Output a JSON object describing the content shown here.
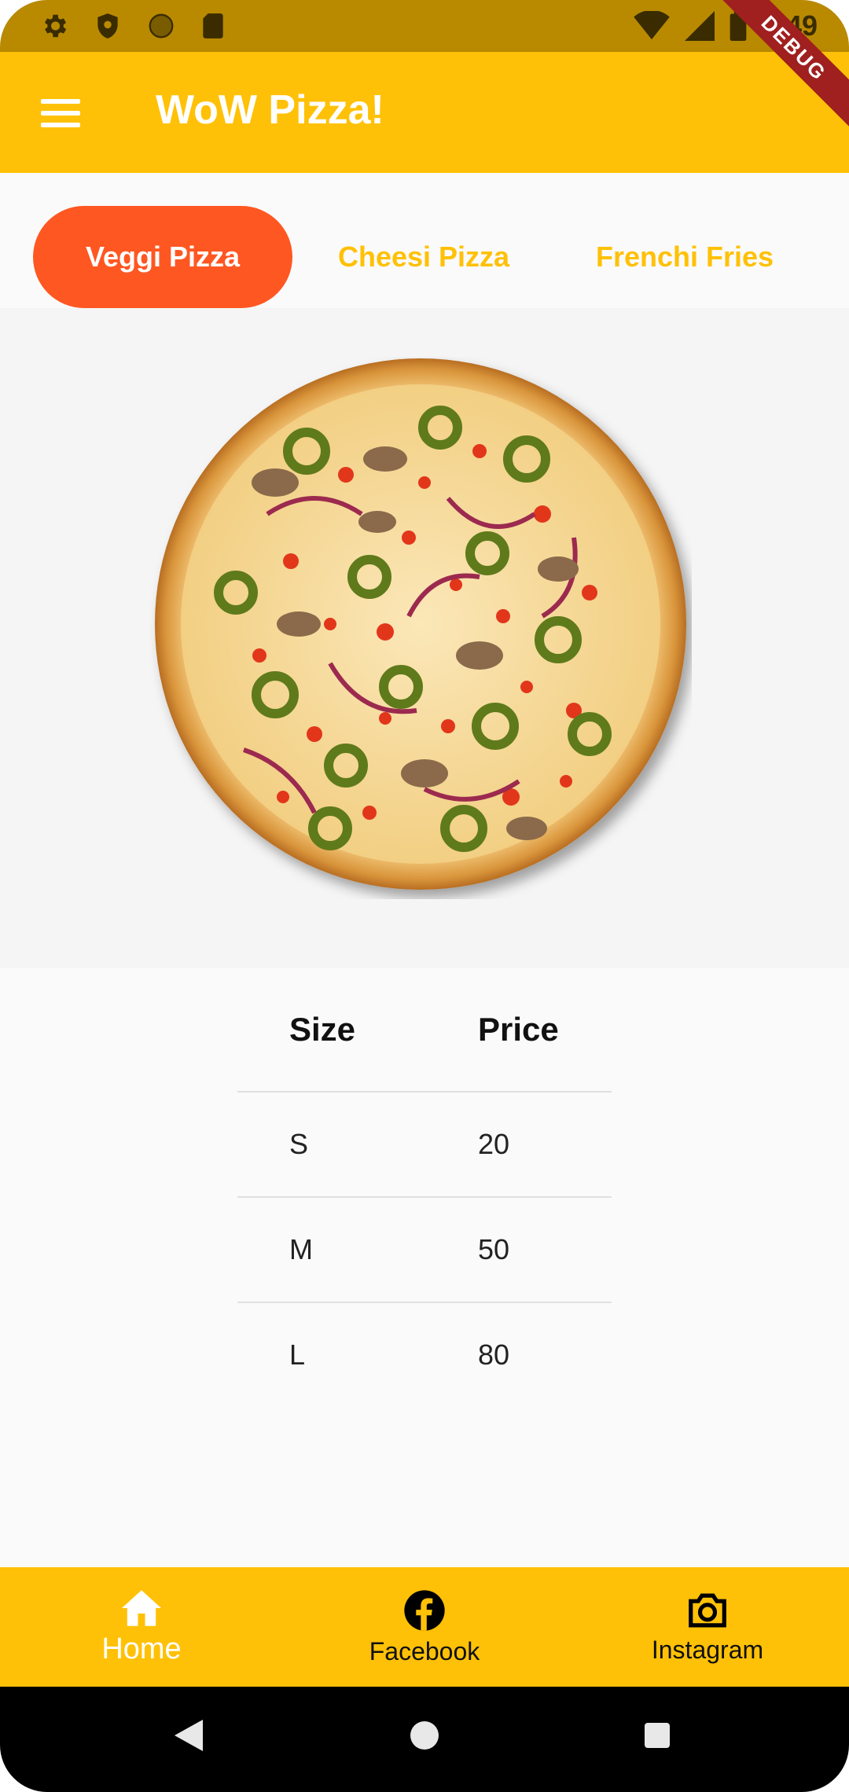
{
  "status_bar": {
    "time": "7:49",
    "left_icons": [
      "gear-icon",
      "shield-icon",
      "circle-icon",
      "sd-card-icon"
    ],
    "right_icons": [
      "wifi-icon",
      "signal-icon",
      "battery-icon"
    ]
  },
  "app_bar": {
    "title": "WoW Pizza!",
    "menu_icon": "hamburger-menu-icon",
    "debug_label": "DEBUG"
  },
  "tabs": [
    {
      "label": "Veggi Pizza",
      "active": true
    },
    {
      "label": "Cheesi Pizza",
      "active": false
    },
    {
      "label": "Frenchi Fries",
      "active": false
    }
  ],
  "product_image": {
    "icon": "pizza-image"
  },
  "price_table": {
    "headers": [
      "Size",
      "Price"
    ],
    "rows": [
      {
        "size": "S",
        "price": "20"
      },
      {
        "size": "M",
        "price": "50"
      },
      {
        "size": "L",
        "price": "80"
      }
    ]
  },
  "bottom_nav": [
    {
      "label": "Home",
      "icon": "home-icon",
      "active": true
    },
    {
      "label": "Facebook",
      "icon": "facebook-icon",
      "active": false
    },
    {
      "label": "Instagram",
      "icon": "camera-icon",
      "active": false
    }
  ],
  "system_nav": [
    "back-icon",
    "home-circle-icon",
    "recents-icon"
  ],
  "colors": {
    "primary": "#ffc107",
    "accent": "#ff5722",
    "status_bar": "#b98a00"
  }
}
